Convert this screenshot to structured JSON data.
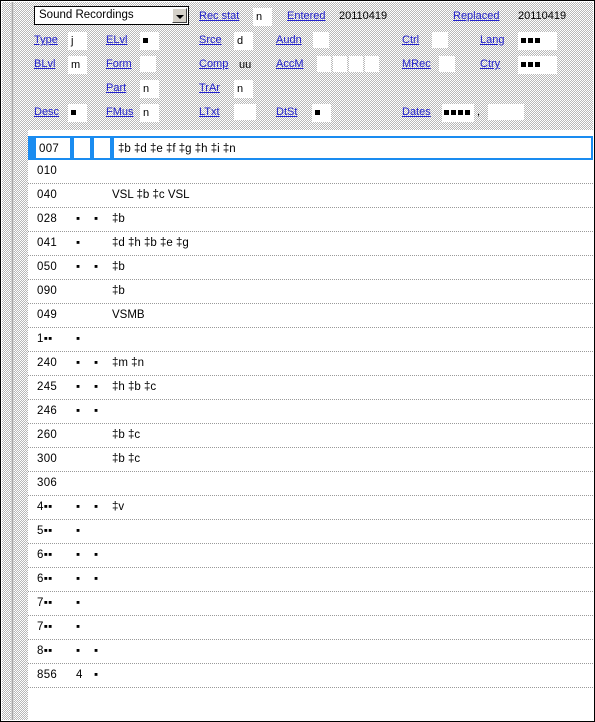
{
  "fixed_field": {
    "record_type_select": {
      "value": "Sound Recordings",
      "arrow_icon": "chevron-down-icon"
    },
    "items": [
      {
        "label": "Rec stat",
        "value": "n"
      },
      {
        "label": "Entered",
        "value": "20110419"
      },
      {
        "label": "Replaced",
        "value": "20110419"
      },
      {
        "label": "Type",
        "value": "j"
      },
      {
        "label": "ELvl",
        "value": "▪"
      },
      {
        "label": "Srce",
        "value": "d"
      },
      {
        "label": "Audn",
        "value": ""
      },
      {
        "label": "Ctrl",
        "value": ""
      },
      {
        "label": "Lang",
        "value": "▪▪▪"
      },
      {
        "label": "BLvl",
        "value": "m"
      },
      {
        "label": "Form",
        "value": ""
      },
      {
        "label": "Comp",
        "value": "uu"
      },
      {
        "label": "AccM",
        "value": ""
      },
      {
        "label": "MRec",
        "value": ""
      },
      {
        "label": "Ctry",
        "value": "▪▪▪"
      },
      {
        "label": "Part",
        "value": "n"
      },
      {
        "label": "TrAr",
        "value": "n"
      },
      {
        "label": "Desc",
        "value": "▪"
      },
      {
        "label": "FMus",
        "value": "n"
      },
      {
        "label": "LTxt",
        "value": ""
      },
      {
        "label": "DtSt",
        "value": "▪"
      },
      {
        "label": "Dates",
        "value": "▪▪▪▪ , "
      }
    ],
    "labels": {
      "rec_stat": "Rec stat",
      "entered": "Entered",
      "replaced": "Replaced",
      "type": "Type",
      "elvl": "ELvl",
      "srce": "Srce",
      "audn": "Audn",
      "ctrl": "Ctrl",
      "lang": "Lang",
      "blvl": "BLvl",
      "form": "Form",
      "comp": "Comp",
      "accm": "AccM",
      "mrec": "MRec",
      "ctry": "Ctry",
      "part": "Part",
      "trar": "TrAr",
      "desc": "Desc",
      "fmus": "FMus",
      "ltxt": "LTxt",
      "dtst": "DtSt",
      "dates": "Dates"
    },
    "values": {
      "rec_stat": "n",
      "entered": "20110419",
      "replaced": "20110419",
      "type": "j",
      "srce": "d",
      "audn": "",
      "ctrl": "",
      "blvl": "m",
      "form": "",
      "comp": "uu",
      "mrec": "",
      "part": "n",
      "trar": "n",
      "fmus": "n",
      "ltxt": "",
      "dates_comma": ","
    }
  },
  "grid": {
    "columns": [
      "tag",
      "ind1",
      "ind2",
      "data"
    ],
    "selected_index": 0,
    "rows": [
      {
        "tag": "007",
        "ind1": "",
        "ind2": "",
        "data": "‡b ‡d ‡e ‡f ‡g ‡h ‡i ‡n",
        "selected": true
      },
      {
        "tag": "010",
        "ind1": "",
        "ind2": "",
        "data": ""
      },
      {
        "tag": "040",
        "ind1": "",
        "ind2": "",
        "data": "VSL ‡b ‡c VSL"
      },
      {
        "tag": "028",
        "ind1": "▪",
        "ind2": "▪",
        "data": "‡b"
      },
      {
        "tag": "041",
        "ind1": "▪",
        "ind2": "",
        "data": "‡d ‡h ‡b ‡e ‡g"
      },
      {
        "tag": "050",
        "ind1": "▪",
        "ind2": "▪",
        "data": "‡b"
      },
      {
        "tag": "090",
        "ind1": "",
        "ind2": "",
        "data": "‡b"
      },
      {
        "tag": "049",
        "ind1": "",
        "ind2": "",
        "data": "VSMB"
      },
      {
        "tag": "1▪▪",
        "ind1": "▪",
        "ind2": "",
        "data": ""
      },
      {
        "tag": "240",
        "ind1": "▪",
        "ind2": "▪",
        "data": "‡m ‡n"
      },
      {
        "tag": "245",
        "ind1": "▪",
        "ind2": "▪",
        "data": "‡h ‡b ‡c"
      },
      {
        "tag": "246",
        "ind1": "▪",
        "ind2": "▪",
        "data": ""
      },
      {
        "tag": "260",
        "ind1": "",
        "ind2": "",
        "data": "‡b ‡c"
      },
      {
        "tag": "300",
        "ind1": "",
        "ind2": "",
        "data": "‡b ‡c"
      },
      {
        "tag": "306",
        "ind1": "",
        "ind2": "",
        "data": ""
      },
      {
        "tag": "4▪▪",
        "ind1": "▪",
        "ind2": "▪",
        "data": "‡v"
      },
      {
        "tag": "5▪▪",
        "ind1": "▪",
        "ind2": "",
        "data": ""
      },
      {
        "tag": "6▪▪",
        "ind1": "▪",
        "ind2": "▪",
        "data": ""
      },
      {
        "tag": "6▪▪",
        "ind1": "▪",
        "ind2": "▪",
        "data": ""
      },
      {
        "tag": "7▪▪",
        "ind1": "▪",
        "ind2": "",
        "data": ""
      },
      {
        "tag": "7▪▪",
        "ind1": "▪",
        "ind2": "",
        "data": ""
      },
      {
        "tag": "8▪▪",
        "ind1": "▪",
        "ind2": "▪",
        "data": ""
      },
      {
        "tag": "856",
        "ind1": "4",
        "ind2": "▪",
        "data": ""
      }
    ]
  },
  "colors": {
    "link": "#2222cc",
    "selection": "#1a8cf0",
    "field_bg": "#ffffff",
    "pane_texture": "#b8b8b8",
    "text": "#000000"
  }
}
